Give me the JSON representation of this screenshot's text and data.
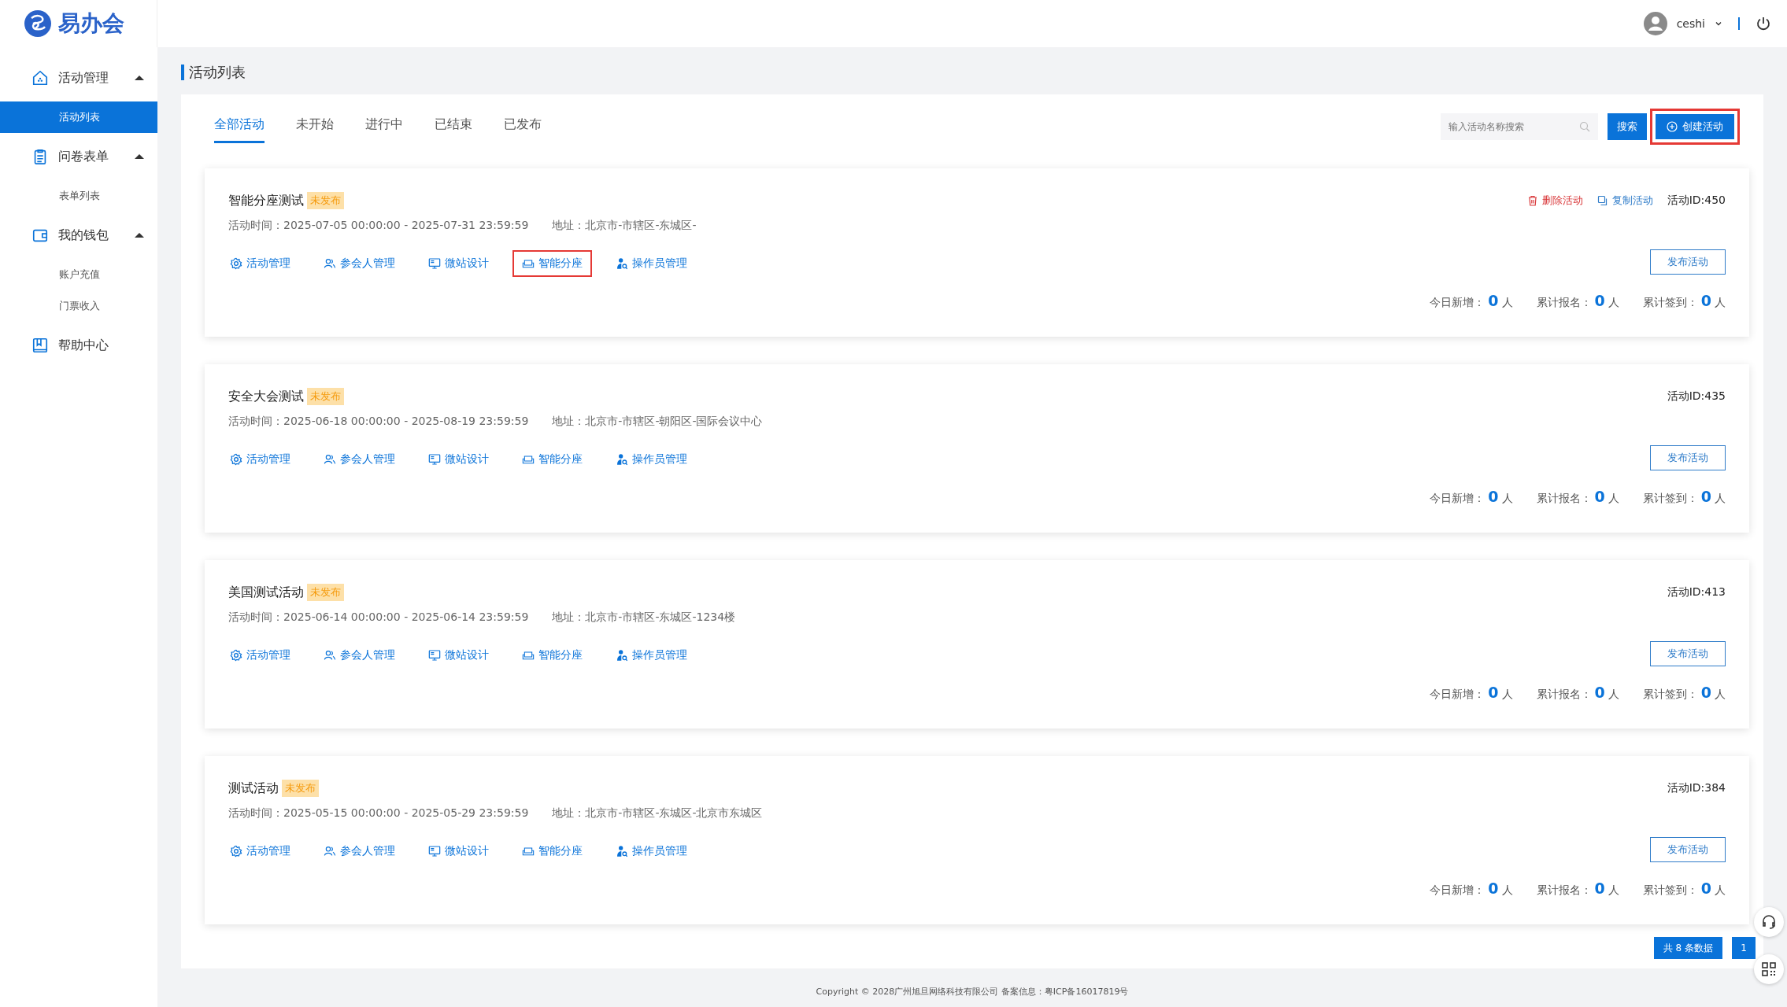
{
  "logo": {
    "text": "易办会"
  },
  "user": {
    "name": "ceshi"
  },
  "sidebar": {
    "items": [
      {
        "label": "活动管理",
        "kind": "house",
        "expanded": true,
        "children": [
          {
            "label": "活动列表",
            "selected": true
          }
        ]
      },
      {
        "label": "问卷表单",
        "kind": "clipboard",
        "expanded": true,
        "children": [
          {
            "label": "表单列表",
            "selected": false
          }
        ]
      },
      {
        "label": "我的钱包",
        "kind": "wallet",
        "expanded": true,
        "children": [
          {
            "label": "账户充值",
            "selected": false
          },
          {
            "label": "门票收入",
            "selected": false
          }
        ]
      },
      {
        "label": "帮助中心",
        "kind": "book"
      }
    ]
  },
  "page_title": "活动列表",
  "tabs": [
    {
      "label": "全部活动",
      "selected": true
    },
    {
      "label": "未开始",
      "selected": false
    },
    {
      "label": "进行中",
      "selected": false
    },
    {
      "label": "已结束",
      "selected": false
    },
    {
      "label": "已发布",
      "selected": false
    }
  ],
  "search": {
    "placeholder": "输入活动名称搜索",
    "button": "搜索"
  },
  "create_button": {
    "label": "创建活动",
    "highlighted": true
  },
  "activities": [
    {
      "title": "智能分座测试",
      "status": "未发布",
      "time": "活动时间：2025-07-05 00:00:00 - 2025-07-31 23:59:59",
      "address": "地址：北京市-市辖区-东城区-",
      "delete": "删除活动",
      "copy": "复制活动",
      "id": "活动ID:450",
      "publish": "发布活动",
      "actions": [
        {
          "kind": "gear",
          "label": "活动管理",
          "highlighted": false
        },
        {
          "kind": "people",
          "label": "参会人管理",
          "highlighted": false
        },
        {
          "kind": "monitor",
          "label": "微站设计",
          "highlighted": false
        },
        {
          "kind": "seat",
          "label": "智能分座",
          "highlighted": true
        },
        {
          "kind": "operator",
          "label": "操作员管理",
          "highlighted": false
        }
      ],
      "stats": [
        {
          "label": "今日新增：",
          "value": "0",
          "unit": "人"
        },
        {
          "label": "累计报名：",
          "value": "0",
          "unit": "人"
        },
        {
          "label": "累计签到：",
          "value": "0",
          "unit": "人"
        }
      ]
    },
    {
      "title": "安全大会测试",
      "status": "未发布",
      "time": "活动时间：2025-06-18 00:00:00 - 2025-08-19 23:59:59",
      "address": "地址：北京市-市辖区-朝阳区-国际会议中心",
      "id": "活动ID:435",
      "publish": "发布活动",
      "actions": [
        {
          "kind": "gear",
          "label": "活动管理",
          "highlighted": false
        },
        {
          "kind": "people",
          "label": "参会人管理",
          "highlighted": false
        },
        {
          "kind": "monitor",
          "label": "微站设计",
          "highlighted": false
        },
        {
          "kind": "seat",
          "label": "智能分座",
          "highlighted": false
        },
        {
          "kind": "operator",
          "label": "操作员管理",
          "highlighted": false
        }
      ],
      "stats": [
        {
          "label": "今日新增：",
          "value": "0",
          "unit": "人"
        },
        {
          "label": "累计报名：",
          "value": "0",
          "unit": "人"
        },
        {
          "label": "累计签到：",
          "value": "0",
          "unit": "人"
        }
      ]
    },
    {
      "title": "美国测试活动",
      "status": "未发布",
      "time": "活动时间：2025-06-14 00:00:00 - 2025-06-14 23:59:59",
      "address": "地址：北京市-市辖区-东城区-1234楼",
      "id": "活动ID:413",
      "publish": "发布活动",
      "actions": [
        {
          "kind": "gear",
          "label": "活动管理",
          "highlighted": false
        },
        {
          "kind": "people",
          "label": "参会人管理",
          "highlighted": false
        },
        {
          "kind": "monitor",
          "label": "微站设计",
          "highlighted": false
        },
        {
          "kind": "seat",
          "label": "智能分座",
          "highlighted": false
        },
        {
          "kind": "operator",
          "label": "操作员管理",
          "highlighted": false
        }
      ],
      "stats": [
        {
          "label": "今日新增：",
          "value": "0",
          "unit": "人"
        },
        {
          "label": "累计报名：",
          "value": "0",
          "unit": "人"
        },
        {
          "label": "累计签到：",
          "value": "0",
          "unit": "人"
        }
      ]
    },
    {
      "title": "测试活动",
      "status": "未发布",
      "time": "活动时间：2025-05-15 00:00:00 - 2025-05-29 23:59:59",
      "address": "地址：北京市-市辖区-东城区-北京市东城区",
      "id": "活动ID:384",
      "publish": "发布活动",
      "actions": [
        {
          "kind": "gear",
          "label": "活动管理",
          "highlighted": false
        },
        {
          "kind": "people",
          "label": "参会人管理",
          "highlighted": false
        },
        {
          "kind": "monitor",
          "label": "微站设计",
          "highlighted": false
        },
        {
          "kind": "seat",
          "label": "智能分座",
          "highlighted": false
        },
        {
          "kind": "operator",
          "label": "操作员管理",
          "highlighted": false
        }
      ],
      "stats": [
        {
          "label": "今日新增：",
          "value": "0",
          "unit": "人"
        },
        {
          "label": "累计报名：",
          "value": "0",
          "unit": "人"
        },
        {
          "label": "累计签到：",
          "value": "0",
          "unit": "人"
        }
      ]
    }
  ],
  "pagination": {
    "total": "共 8 条数据",
    "pages": [
      {
        "label": "1",
        "selected": true
      }
    ]
  },
  "footer": "Copyright © 2028广州旭旦网络科技有限公司 备案信息：粤ICP备16017819号"
}
